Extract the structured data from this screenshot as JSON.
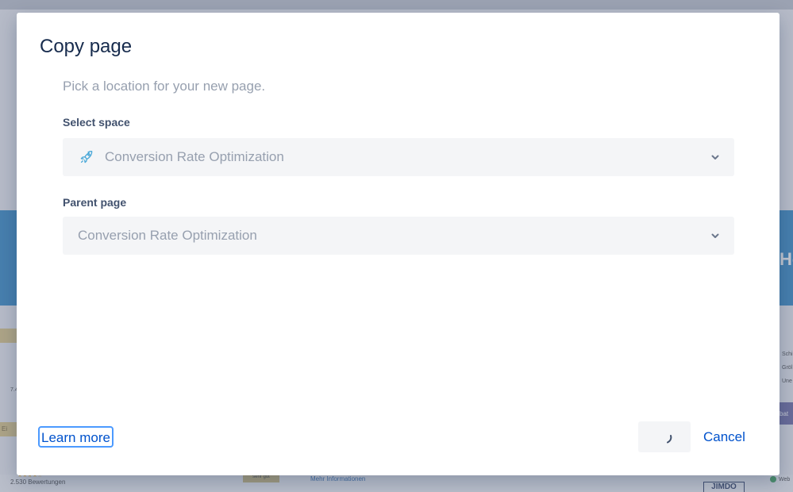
{
  "background": {
    "banner_text": "Ho To",
    "left_tag": "Ei",
    "left_number": "7.4",
    "rating_stars": "★★★★☆",
    "rating_count": "2.530 Bewertungen",
    "badge": "sehr gut",
    "link": "Mehr Informationen",
    "logo": "JIMDO",
    "right_list": [
      "Schi",
      "Gröl",
      "Une"
    ],
    "right_button": "bat",
    "right_check": "Web"
  },
  "modal": {
    "title": "Copy page",
    "description": "Pick a location for your new page.",
    "space_label": "Select space",
    "space_value": "Conversion Rate Optimization",
    "space_icon": "rocket-icon",
    "parent_label": "Parent page",
    "parent_value": "Conversion Rate Optimization",
    "learn_more": "Learn more",
    "cancel": "Cancel"
  },
  "colors": {
    "primary_link": "#0052cc",
    "focus_ring": "#4c9aff",
    "select_bg": "#f4f5f7",
    "muted_text": "#97a0af",
    "title_text": "#172b4d",
    "rocket_icon": "#4aa8d8"
  }
}
